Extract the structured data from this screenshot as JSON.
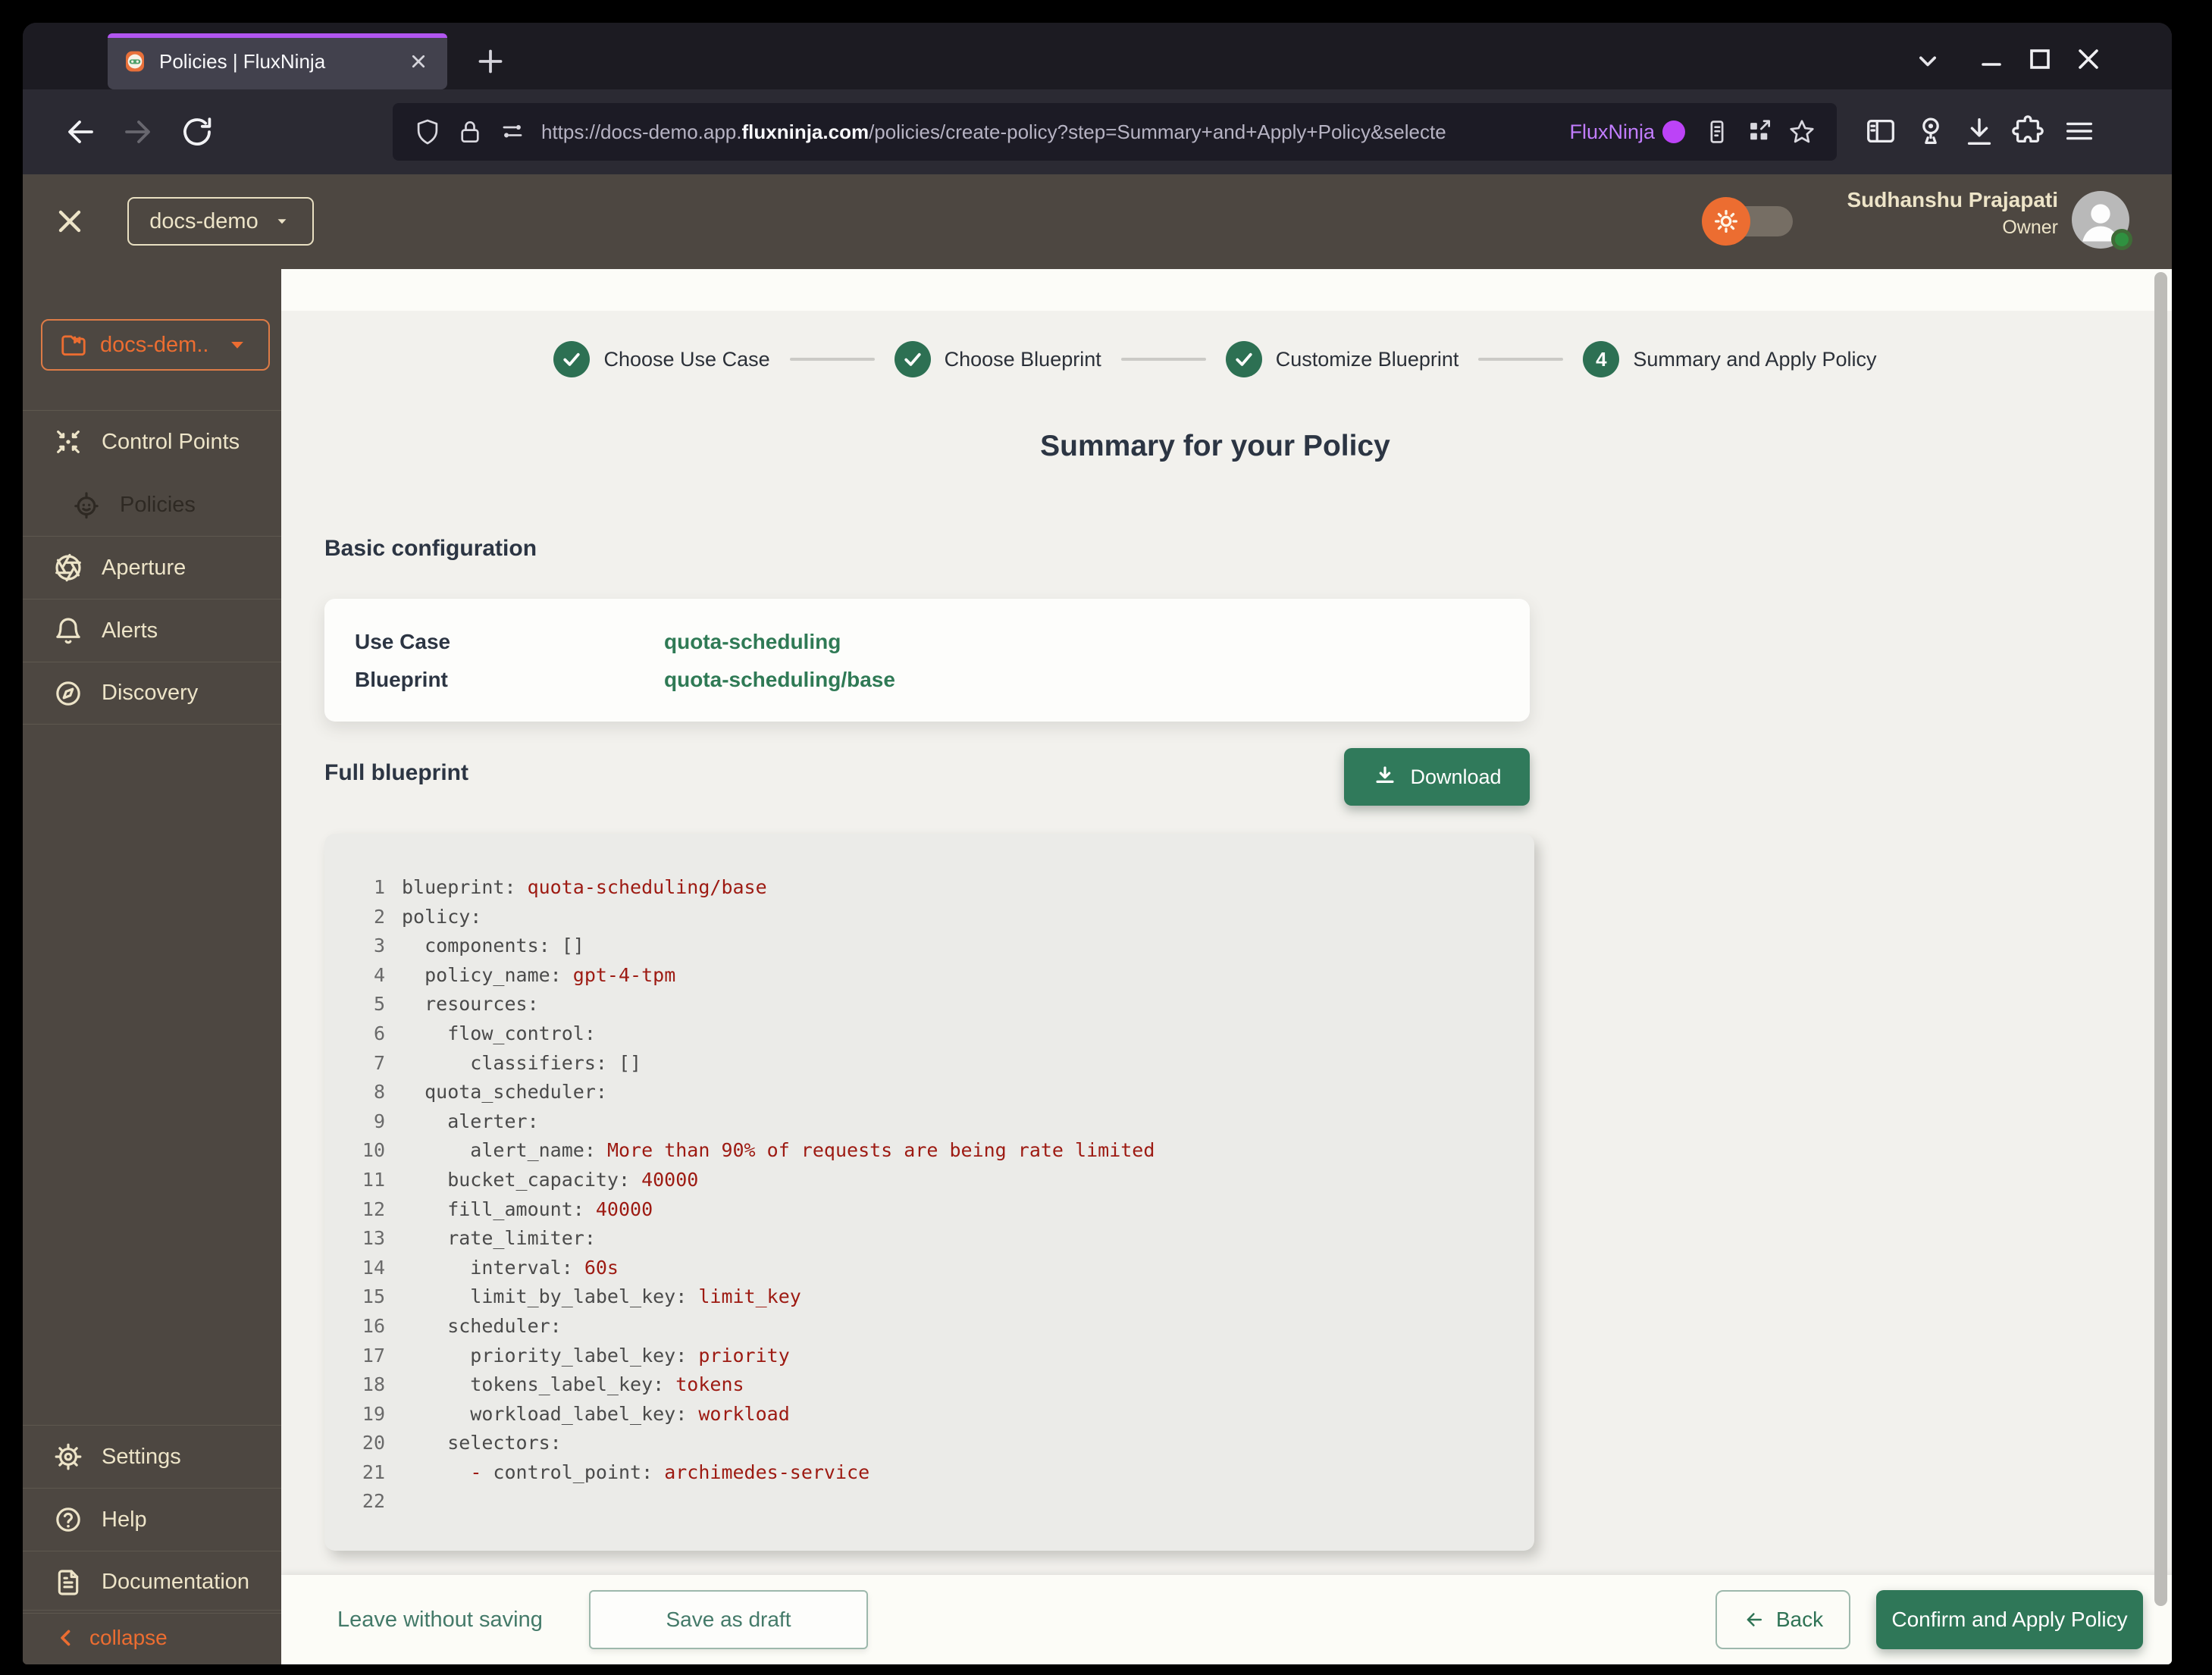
{
  "browser": {
    "tab_title": "Policies | FluxNinja",
    "new_tab_tooltip": "+",
    "url_prefix": "https://docs-demo.app.",
    "url_domain": "fluxninja.com",
    "url_suffix": "/policies/create-policy?step=Summary+and+Apply+Policy&selecte",
    "container_label": "FluxNinja",
    "container_color": "#bc43f7",
    "tab_accent_color": "#b156f0"
  },
  "header": {
    "org_selector": "docs-demo",
    "user_name": "Sudhanshu Prajapati",
    "user_role": "Owner"
  },
  "sidebar": {
    "project_selector": "docs-dem...",
    "items": [
      {
        "label": "Control Points",
        "icon": "control-points-icon",
        "active": false
      },
      {
        "label": "Policies",
        "icon": "policies-icon",
        "active": true
      },
      {
        "label": "Aperture",
        "icon": "aperture-icon",
        "active": false
      },
      {
        "label": "Alerts",
        "icon": "alerts-icon",
        "active": false
      },
      {
        "label": "Discovery",
        "icon": "discovery-icon",
        "active": false
      }
    ],
    "footer_items": [
      {
        "label": "Settings",
        "icon": "settings-icon"
      },
      {
        "label": "Help",
        "icon": "help-icon"
      },
      {
        "label": "Documentation",
        "icon": "documentation-icon"
      }
    ],
    "collapse_label": "collapse",
    "accent_color": "#ed6e31"
  },
  "wizard": {
    "steps": [
      {
        "label": "Choose Use Case",
        "state": "done"
      },
      {
        "label": "Choose Blueprint",
        "state": "done"
      },
      {
        "label": "Customize Blueprint",
        "state": "done"
      },
      {
        "label": "Summary and Apply Policy",
        "state": "current",
        "number": "4"
      }
    ],
    "step_color": "#2d7053",
    "title": "Summary for your Policy",
    "basic_config": {
      "heading": "Basic configuration",
      "rows": [
        {
          "label": "Use Case",
          "value": "quota-scheduling"
        },
        {
          "label": "Blueprint",
          "value": "quota-scheduling/base"
        }
      ],
      "value_color": "#2f7a55"
    },
    "full_blueprint": {
      "heading": "Full blueprint",
      "download_label": "Download"
    },
    "code": {
      "key_color": "#4a4a4a",
      "value_color": "#9d1a12",
      "lines": [
        {
          "n": "1",
          "segs": [
            [
              "k",
              "blueprint: "
            ],
            [
              "v",
              "quota-scheduling/base"
            ]
          ]
        },
        {
          "n": "2",
          "segs": [
            [
              "k",
              "policy:"
            ]
          ]
        },
        {
          "n": "3",
          "segs": [
            [
              "k",
              "  components: []"
            ]
          ]
        },
        {
          "n": "4",
          "segs": [
            [
              "k",
              "  policy_name: "
            ],
            [
              "v",
              "gpt-4-tpm"
            ]
          ]
        },
        {
          "n": "5",
          "segs": [
            [
              "k",
              "  resources:"
            ]
          ]
        },
        {
          "n": "6",
          "segs": [
            [
              "k",
              "    flow_control:"
            ]
          ]
        },
        {
          "n": "7",
          "segs": [
            [
              "k",
              "      classifiers: []"
            ]
          ]
        },
        {
          "n": "8",
          "segs": [
            [
              "k",
              "  quota_scheduler:"
            ]
          ]
        },
        {
          "n": "9",
          "segs": [
            [
              "k",
              "    alerter:"
            ]
          ]
        },
        {
          "n": "10",
          "segs": [
            [
              "k",
              "      alert_name: "
            ],
            [
              "v",
              "More than 90% of requests are being rate limited"
            ]
          ]
        },
        {
          "n": "11",
          "segs": [
            [
              "k",
              "    bucket_capacity: "
            ],
            [
              "v",
              "40000"
            ]
          ]
        },
        {
          "n": "12",
          "segs": [
            [
              "k",
              "    fill_amount: "
            ],
            [
              "v",
              "40000"
            ]
          ]
        },
        {
          "n": "13",
          "segs": [
            [
              "k",
              "    rate_limiter:"
            ]
          ]
        },
        {
          "n": "14",
          "segs": [
            [
              "k",
              "      interval: "
            ],
            [
              "v",
              "60s"
            ]
          ]
        },
        {
          "n": "15",
          "segs": [
            [
              "k",
              "      limit_by_label_key: "
            ],
            [
              "v",
              "limit_key"
            ]
          ]
        },
        {
          "n": "16",
          "segs": [
            [
              "k",
              "    scheduler:"
            ]
          ]
        },
        {
          "n": "17",
          "segs": [
            [
              "k",
              "      priority_label_key: "
            ],
            [
              "v",
              "priority"
            ]
          ]
        },
        {
          "n": "18",
          "segs": [
            [
              "k",
              "      tokens_label_key: "
            ],
            [
              "v",
              "tokens"
            ]
          ]
        },
        {
          "n": "19",
          "segs": [
            [
              "k",
              "      workload_label_key: "
            ],
            [
              "v",
              "workload"
            ]
          ]
        },
        {
          "n": "20",
          "segs": [
            [
              "k",
              "    selectors:"
            ]
          ]
        },
        {
          "n": "21",
          "segs": [
            [
              "k",
              "      "
            ],
            [
              "v",
              "-"
            ],
            [
              "k",
              " control_point: "
            ],
            [
              "v",
              "archimedes-service"
            ]
          ]
        },
        {
          "n": "22",
          "segs": []
        }
      ]
    }
  },
  "footer_bar": {
    "leave_label": "Leave without saving",
    "save_draft_label": "Save as draft",
    "back_label": "Back",
    "confirm_label": "Confirm and Apply Policy",
    "confirm_color": "#2f7758"
  }
}
